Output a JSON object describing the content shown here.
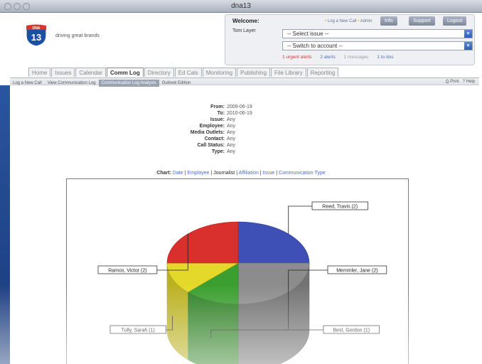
{
  "window": {
    "title": "dna13"
  },
  "brand": {
    "logo_text": "DNA",
    "logo_number": "13",
    "tagline": "driving great brands"
  },
  "header": {
    "welcome_label": "Welcome:",
    "user_name": "Tom Layer",
    "links": {
      "new_call": "Log a New Call",
      "admin": "Admin"
    },
    "buttons": {
      "info": "Info",
      "support": "Support",
      "logout": "Logout"
    },
    "issue_select": "-- Select issue --",
    "account_select": "-- Switch to account --",
    "alerts": {
      "urgent": "1 urgent alerts",
      "alerts": "2 alerts",
      "messages": "1 messages",
      "todo": "1 to dos"
    }
  },
  "tabs": [
    {
      "label": "Home",
      "active": false
    },
    {
      "label": "Issues",
      "active": false
    },
    {
      "label": "Calendar",
      "active": false
    },
    {
      "label": "Comm Log",
      "active": true
    },
    {
      "label": "Directory",
      "active": false
    },
    {
      "label": "Ed Cals",
      "active": false
    },
    {
      "label": "Monitoring",
      "active": false
    },
    {
      "label": "Publishing",
      "active": false
    },
    {
      "label": "File Library",
      "active": false
    },
    {
      "label": "Reporting",
      "active": false
    }
  ],
  "subnav": {
    "items": [
      {
        "label": "Log a New Call",
        "active": false
      },
      {
        "label": "View Communication Log",
        "active": false
      },
      {
        "label": "Communication Log Analysis",
        "active": true
      },
      {
        "label": "Outlook Edition",
        "active": false
      }
    ],
    "print": "Print",
    "help": "Help"
  },
  "filters": [
    {
      "label": "From:",
      "value": "2009-06-19"
    },
    {
      "label": "To:",
      "value": "2010-06-19"
    },
    {
      "label": "Issue:",
      "value": "Any"
    },
    {
      "label": "Employee:",
      "value": "Any"
    },
    {
      "label": "Media Outlets:",
      "value": "Any"
    },
    {
      "label": "Contact:",
      "value": "Any"
    },
    {
      "label": "Call Status:",
      "value": "Any"
    },
    {
      "label": "Type:",
      "value": "Any"
    }
  ],
  "chart_nav": {
    "label": "Chart:",
    "options": [
      {
        "label": "Date",
        "current": false
      },
      {
        "label": "Employee",
        "current": false
      },
      {
        "label": "Journalist",
        "current": true
      },
      {
        "label": "Affiliation",
        "current": false
      },
      {
        "label": "Issue",
        "current": false
      },
      {
        "label": "Communication Type",
        "current": false
      }
    ]
  },
  "colors": {
    "blue": "#3e4fb5",
    "gray": "#8c8c8c",
    "green": "#3a9f2e",
    "yellow": "#e4d92a",
    "red": "#d9302d",
    "link": "#4b6fc4",
    "urgent": "#d33"
  },
  "chart_data": {
    "type": "pie",
    "categories": [
      "Reed, Travis",
      "Memmler, Jane",
      "Best, Gordon",
      "Tully, Sarah",
      "Ramos, Victor"
    ],
    "values": [
      2,
      2,
      1,
      1,
      2
    ],
    "labels": [
      "Reed, Travis (2)",
      "Memmler, Jane (2)",
      "Best, Gordon (1)",
      "Tully, Sarah (1)",
      "Ramos, Victor (2)"
    ],
    "colors": [
      "#3e4fb5",
      "#8c8c8c",
      "#3a9f2e",
      "#e4d92a",
      "#d9302d"
    ]
  }
}
